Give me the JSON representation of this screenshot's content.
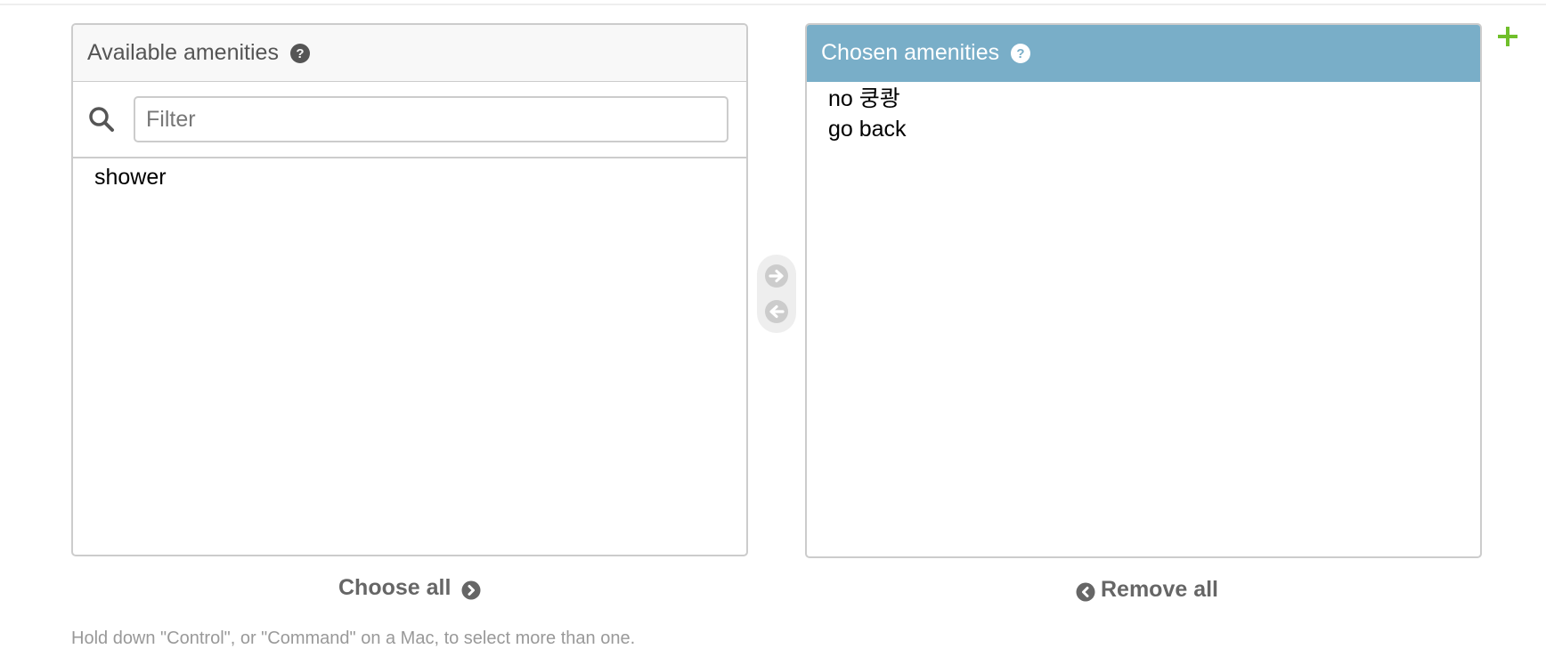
{
  "available": {
    "title": "Available amenities",
    "filter_placeholder": "Filter",
    "options": [
      "shower"
    ]
  },
  "chosen": {
    "title": "Chosen amenities",
    "options": [
      "no 쿵쾅",
      "go back"
    ]
  },
  "actions": {
    "choose_all": "Choose all",
    "remove_all": "Remove all"
  },
  "help_text": "Hold down \"Control\", or \"Command\" on a Mac, to select more than one.",
  "colors": {
    "chosen_header": "#79aec8",
    "add_icon": "#70bf2b",
    "link_gray": "#666666"
  },
  "icons": {
    "help": "question-circle-icon",
    "search": "search-icon",
    "add": "plus-icon",
    "move_right": "arrow-circle-right-icon",
    "move_left": "arrow-circle-left-icon",
    "choose_all": "chevron-circle-right-icon",
    "remove_all": "chevron-circle-left-icon"
  }
}
